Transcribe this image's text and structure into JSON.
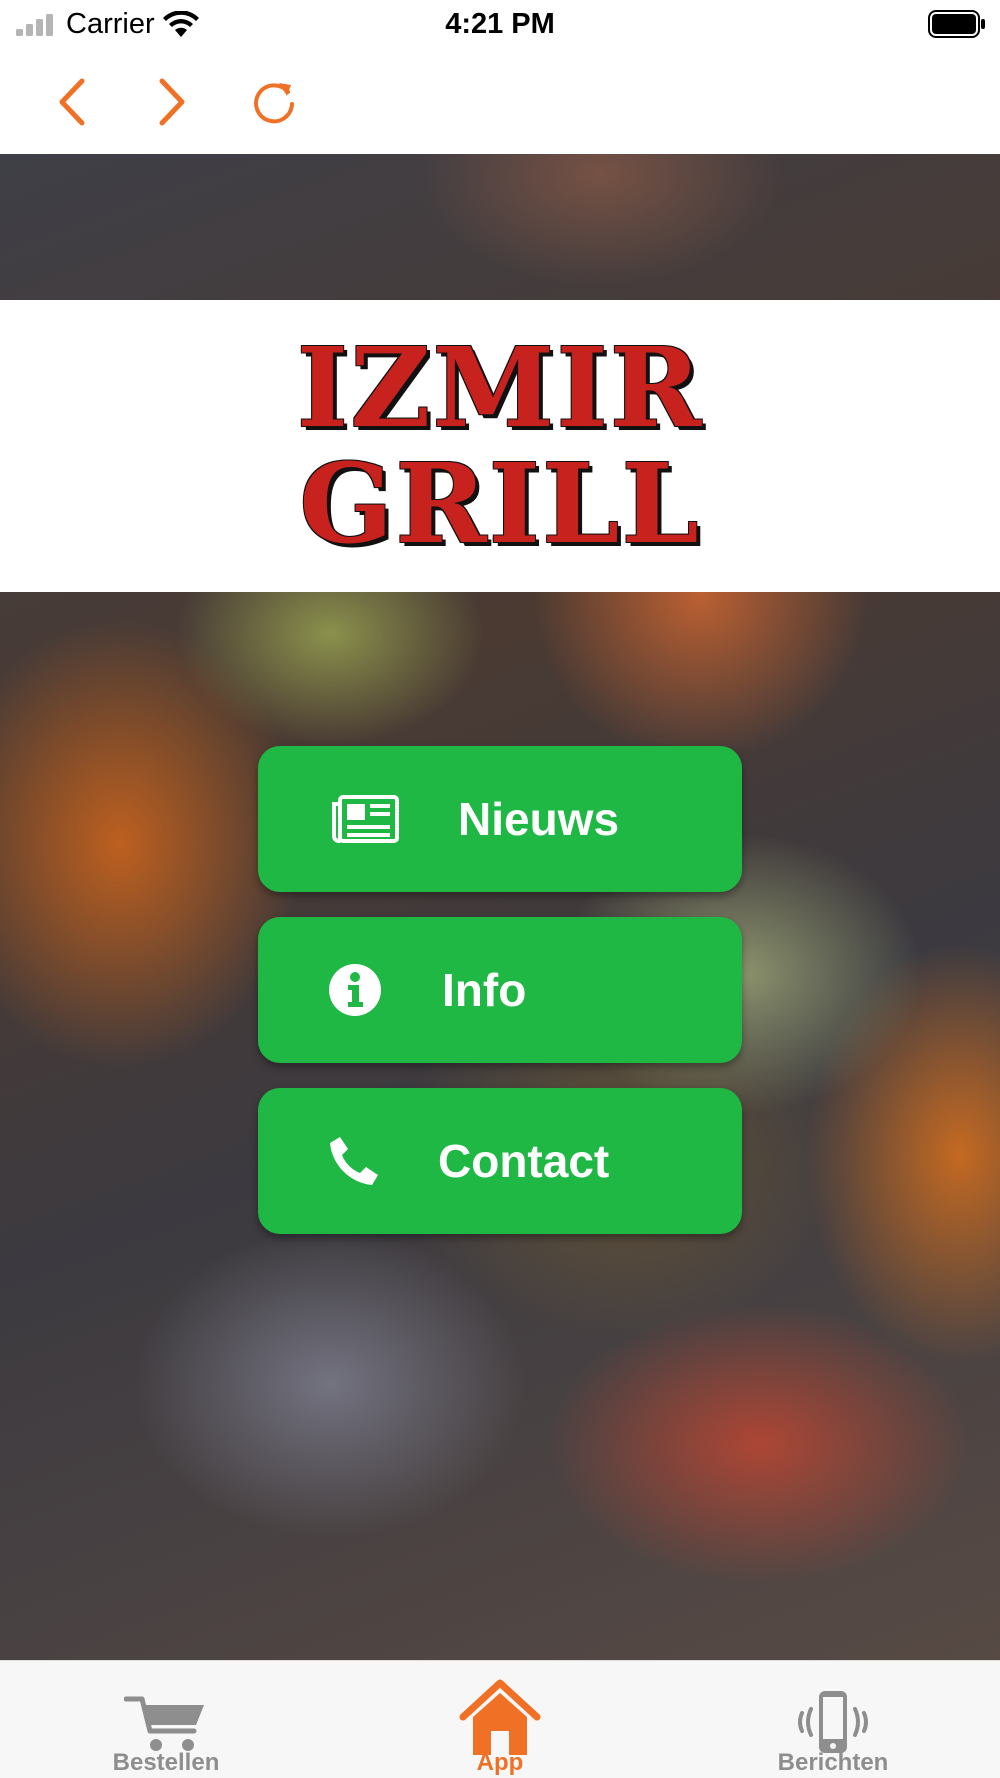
{
  "status_bar": {
    "carrier": "Carrier",
    "time": "4:21 PM"
  },
  "browser_toolbar": {
    "accent_color": "#f07126",
    "icons": [
      "chevron-left-icon",
      "chevron-right-icon",
      "reload-icon"
    ]
  },
  "logo": {
    "line1": "IZMIR",
    "line2": "GRILL",
    "color": "#c8221f"
  },
  "menu": {
    "button_color": "#1fb845",
    "items": [
      {
        "label": "Nieuws",
        "icon": "newspaper-icon"
      },
      {
        "label": "Info",
        "icon": "info-icon"
      },
      {
        "label": "Contact",
        "icon": "phone-icon"
      }
    ]
  },
  "tab_bar": {
    "active_color": "#f07126",
    "inactive_color": "#8e8e8e",
    "items": [
      {
        "label": "Bestellen",
        "icon": "cart-icon",
        "active": false
      },
      {
        "label": "App",
        "icon": "home-icon",
        "active": true
      },
      {
        "label": "Berichten",
        "icon": "phone-vibrate-icon",
        "active": false
      }
    ]
  }
}
